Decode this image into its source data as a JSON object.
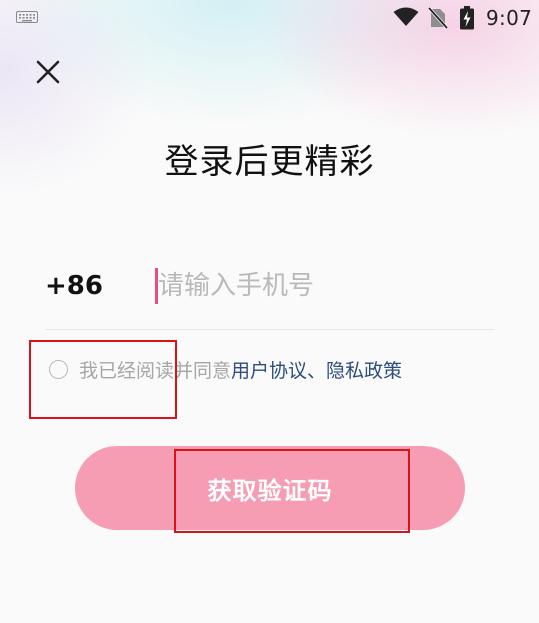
{
  "status_bar": {
    "time": "9:07",
    "icons": [
      "keyboard-icon",
      "wifi-icon",
      "no-sim-icon",
      "battery-charging-icon"
    ]
  },
  "header": {
    "close_icon": "close-icon"
  },
  "login": {
    "title": "登录后更精彩",
    "country_code": "+86",
    "phone_value": "",
    "phone_placeholder": "请输入手机号",
    "agreement": {
      "checked": false,
      "prefix": "我已经阅读并同意",
      "user_agreement": "用户协议",
      "separator": "、",
      "privacy_policy": "隐私政策"
    },
    "get_code_label": "获取验证码"
  },
  "colors": {
    "accent": "#f79db3",
    "link": "#2d4c80",
    "caret": "#e8507a",
    "highlight": "#d8141a"
  }
}
